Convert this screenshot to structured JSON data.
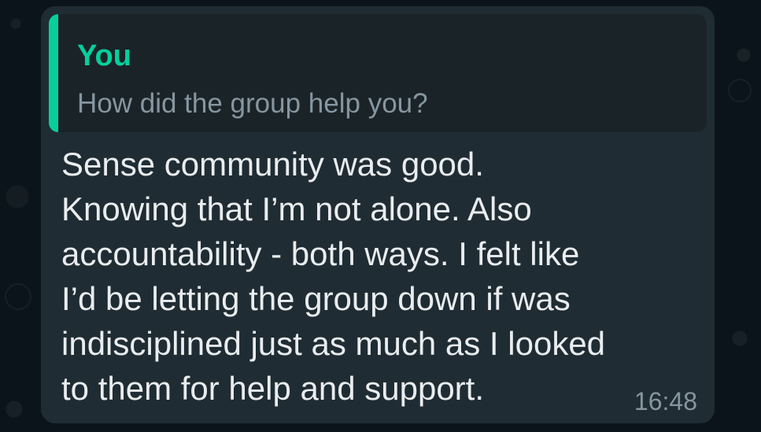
{
  "chat": {
    "quoted_message": {
      "author": "You",
      "text": "How did the group help you?"
    },
    "message": {
      "lines": [
        "Sense community was good.",
        "Knowing that I’m not alone. Also",
        "accountability - both ways. I felt like",
        "I’d be letting the group down if was",
        "indisciplined just as much as I looked",
        "to them for help and support."
      ],
      "time": "16:48"
    }
  },
  "colors": {
    "background": "#0b141a",
    "bubble": "#202c33",
    "quote_background": "#1a2328",
    "accent": "#06cf9c",
    "primary_text": "#e9edef",
    "secondary_text": "#8696a0"
  }
}
